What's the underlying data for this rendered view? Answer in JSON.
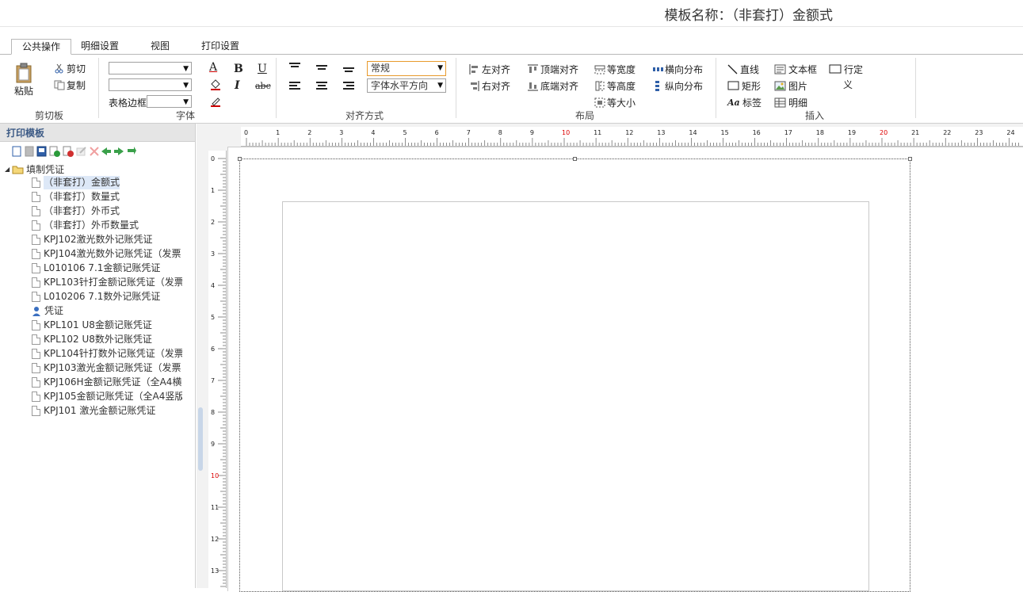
{
  "header": {
    "title": "模板名称：（非套打）金额式"
  },
  "tabs": [
    "公共操作",
    "明细设置",
    "视图",
    "打印设置"
  ],
  "ribbon": {
    "clipboard": {
      "paste": "粘贴",
      "cut": "剪切",
      "copy": "复制",
      "label": "剪切板"
    },
    "font": {
      "font_name": "",
      "font_size": "",
      "border_label": "表格边框",
      "border_value": "",
      "label": "字体",
      "bold": "B",
      "italic": "I",
      "underline": "U",
      "strike": "abc",
      "font_color": "A"
    },
    "align": {
      "style": "常规",
      "direction": "字体水平方向",
      "label": "对齐方式"
    },
    "layout": {
      "left": "左对齐",
      "right": "右对齐",
      "top": "顶端对齐",
      "bottom": "底端对齐",
      "same_width": "等宽度",
      "same_height": "等高度",
      "same_size": "等大小",
      "h_dist": "横向分布",
      "v_dist": "纵向分布",
      "label": "布局"
    },
    "insert": {
      "line": "直线",
      "rect": "矩形",
      "tag": "标签",
      "textbox": "文本框",
      "image": "图片",
      "detail": "明细",
      "custom_1": "行定",
      "custom_2": "义",
      "label": "插入"
    }
  },
  "left_panel": {
    "title": "打印模板",
    "root": "填制凭证",
    "items": [
      "（非套打）金额式",
      "（非套打）数量式",
      "（非套打）外币式",
      "（非套打）外币数量式",
      "KPJ102激光数外记账凭证",
      "KPJ104激光数外记账凭证（发票",
      "L010106 7.1金额记账凭证",
      "KPL103针打金额记账凭证（发票",
      "L010206 7.1数外记账凭证",
      "凭证",
      "KPL101 U8金额记账凭证",
      "KPL102 U8数外记账凭证",
      "KPL104针打数外记账凭证（发票",
      "KPJ103激光金额记账凭证（发票",
      "KPJ106H金额记账凭证（全A4横",
      "KPJ105金额记账凭证（全A4竖版",
      "KPJ101 激光金额记账凭证"
    ]
  },
  "ruler": {
    "h": [
      "0",
      "1",
      "2",
      "3",
      "4",
      "5",
      "6",
      "7",
      "8",
      "9",
      "10",
      "11",
      "12",
      "13",
      "14",
      "15",
      "16",
      "17",
      "18",
      "19",
      "20",
      "21",
      "22",
      "23",
      "24"
    ],
    "v": [
      "0",
      "1",
      "2",
      "3",
      "4",
      "5",
      "6",
      "7",
      "8",
      "9",
      "10",
      "11",
      "12",
      "13"
    ]
  }
}
